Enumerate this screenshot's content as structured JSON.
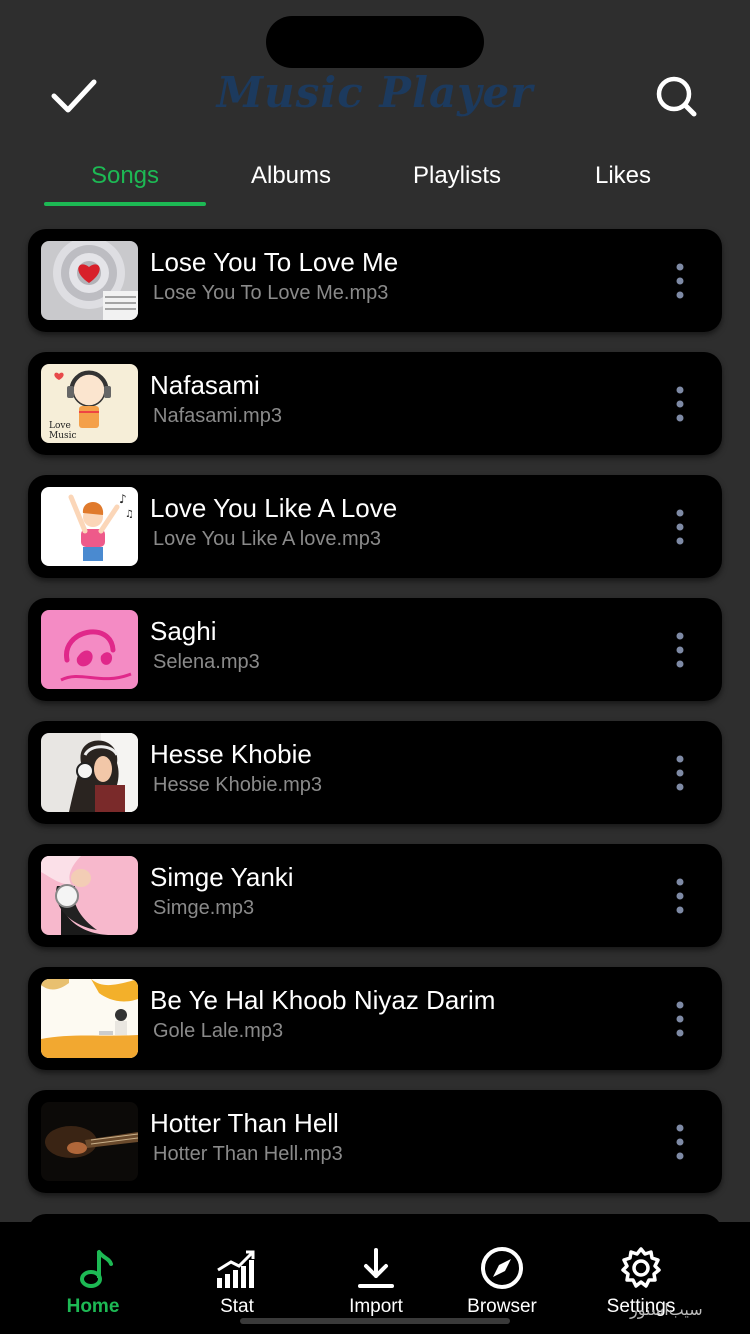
{
  "header": {
    "title": "Music Player",
    "check_icon": "check-icon",
    "search_icon": "search-icon"
  },
  "tabs": [
    {
      "label": "Songs",
      "active": true
    },
    {
      "label": "Albums",
      "active": false
    },
    {
      "label": "Playlists",
      "active": false
    },
    {
      "label": "Likes",
      "active": false
    }
  ],
  "songs": [
    {
      "title": "Lose You To Love Me",
      "file": "Lose You To Love Me.mp3"
    },
    {
      "title": "Nafasami",
      "file": "Nafasami.mp3",
      "thumb_text": "Love Music"
    },
    {
      "title": "Love You Like A Love",
      "file": "Love You Like A love.mp3"
    },
    {
      "title": "Saghi",
      "file": "Selena.mp3"
    },
    {
      "title": "Hesse Khobie",
      "file": "Hesse Khobie.mp3"
    },
    {
      "title": "Simge Yanki",
      "file": "Simge.mp3"
    },
    {
      "title": "Be Ye Hal Khoob Niyaz Darim",
      "file": "Gole Lale.mp3"
    },
    {
      "title": "Hotter Than Hell",
      "file": "Hotter Than Hell.mp3"
    }
  ],
  "bottom_nav": [
    {
      "label": "Home",
      "icon": "music-note-icon",
      "active": true
    },
    {
      "label": "Stat",
      "icon": "stats-chart-icon",
      "active": false
    },
    {
      "label": "Import",
      "icon": "download-icon",
      "active": false
    },
    {
      "label": "Browser",
      "icon": "compass-icon",
      "active": false
    },
    {
      "label": "Settings",
      "icon": "gear-icon",
      "active": false
    }
  ],
  "watermark": "سیب‌اسنور",
  "colors": {
    "accent": "#1db954",
    "background": "#2e2e2e",
    "card": "#000000",
    "title": "#1c3a5e",
    "secondary_text": "#8a8a8a"
  }
}
